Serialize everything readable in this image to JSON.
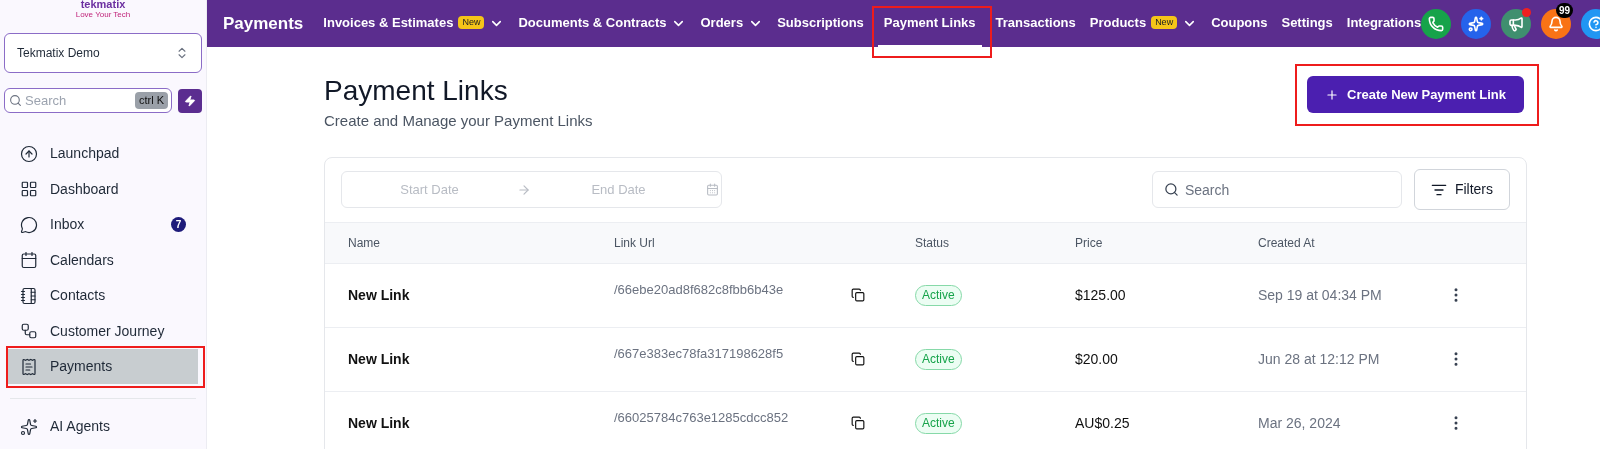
{
  "sidebar": {
    "logo": {
      "name": "tekmatix",
      "tagline": "Love Your Tech"
    },
    "workspace": "Tekmatix Demo",
    "search": {
      "placeholder": "Search",
      "shortcut": "ctrl K"
    },
    "items": [
      {
        "kind": "launchpad",
        "label": "Launchpad",
        "selected": false,
        "highlighted": false
      },
      {
        "kind": "dashboard",
        "label": "Dashboard",
        "selected": false,
        "highlighted": false
      },
      {
        "kind": "inbox",
        "label": "Inbox",
        "selected": false,
        "highlighted": false,
        "count": "7"
      },
      {
        "kind": "calendars",
        "label": "Calendars",
        "selected": false,
        "highlighted": false
      },
      {
        "kind": "contacts",
        "label": "Contacts",
        "selected": false,
        "highlighted": false
      },
      {
        "kind": "journey",
        "label": "Customer Journey",
        "selected": false,
        "highlighted": false
      },
      {
        "kind": "payments",
        "label": "Payments",
        "selected": true,
        "highlighted": true
      }
    ],
    "items_after_divider": [
      {
        "kind": "agents",
        "label": "AI Agents",
        "selected": false,
        "highlighted": false
      }
    ]
  },
  "topbar": {
    "title": "Payments",
    "tabs": [
      {
        "label": "Invoices & Estimates",
        "badge": "New",
        "dropdown": true,
        "selected": false,
        "highlighted": false
      },
      {
        "label": "Documents & Contracts",
        "dropdown": true,
        "selected": false,
        "highlighted": false
      },
      {
        "label": "Orders",
        "dropdown": true,
        "selected": false,
        "highlighted": false
      },
      {
        "label": "Subscriptions",
        "dropdown": false,
        "selected": false,
        "highlighted": false
      },
      {
        "label": "Payment Links",
        "dropdown": false,
        "selected": true,
        "highlighted": true
      },
      {
        "label": "Transactions",
        "dropdown": false,
        "selected": false,
        "highlighted": false
      },
      {
        "label": "Products",
        "badge": "New",
        "dropdown": true,
        "selected": false,
        "highlighted": false
      },
      {
        "label": "Coupons",
        "dropdown": false,
        "selected": false,
        "highlighted": false
      },
      {
        "label": "Settings",
        "dropdown": false,
        "selected": false,
        "highlighted": false
      },
      {
        "label": "Integrations",
        "dropdown": false,
        "selected": false,
        "highlighted": false
      }
    ],
    "actions": [
      {
        "kind": "phone",
        "color": "#16a34a"
      },
      {
        "kind": "sparkle",
        "color": "#2563eb"
      },
      {
        "kind": "megaphone",
        "color": "#3f8f6f",
        "dot": true
      },
      {
        "kind": "bell",
        "color": "#f97316",
        "count": "99"
      },
      {
        "kind": "help",
        "color": "#2196f3"
      }
    ]
  },
  "page": {
    "title": "Payment Links",
    "subtitle": "Create and Manage your Payment Links",
    "create_button": {
      "label": "Create New Payment Link",
      "highlighted": true
    },
    "date_range": {
      "start_placeholder": "Start Date",
      "end_placeholder": "End Date"
    },
    "search": {
      "placeholder": "Search"
    },
    "filters_button": "Filters",
    "table": {
      "columns": [
        "Name",
        "Link Url",
        "Status",
        "Price",
        "Created At"
      ],
      "rows": [
        {
          "name": "New Link",
          "url": "/66ebe20ad8f682c8fbb6b43e",
          "status": "Active",
          "price": "$125.00",
          "created": "Sep 19 at 04:34 PM"
        },
        {
          "name": "New Link",
          "url": "/667e383ec78fa317198628f5",
          "status": "Active",
          "price": "$20.00",
          "created": "Jun 28 at 12:12 PM"
        },
        {
          "name": "New Link",
          "url": "/66025784c763e1285cdcc852",
          "status": "Active",
          "price": "AU$0.25",
          "created": "Mar 26, 2024"
        }
      ]
    }
  }
}
